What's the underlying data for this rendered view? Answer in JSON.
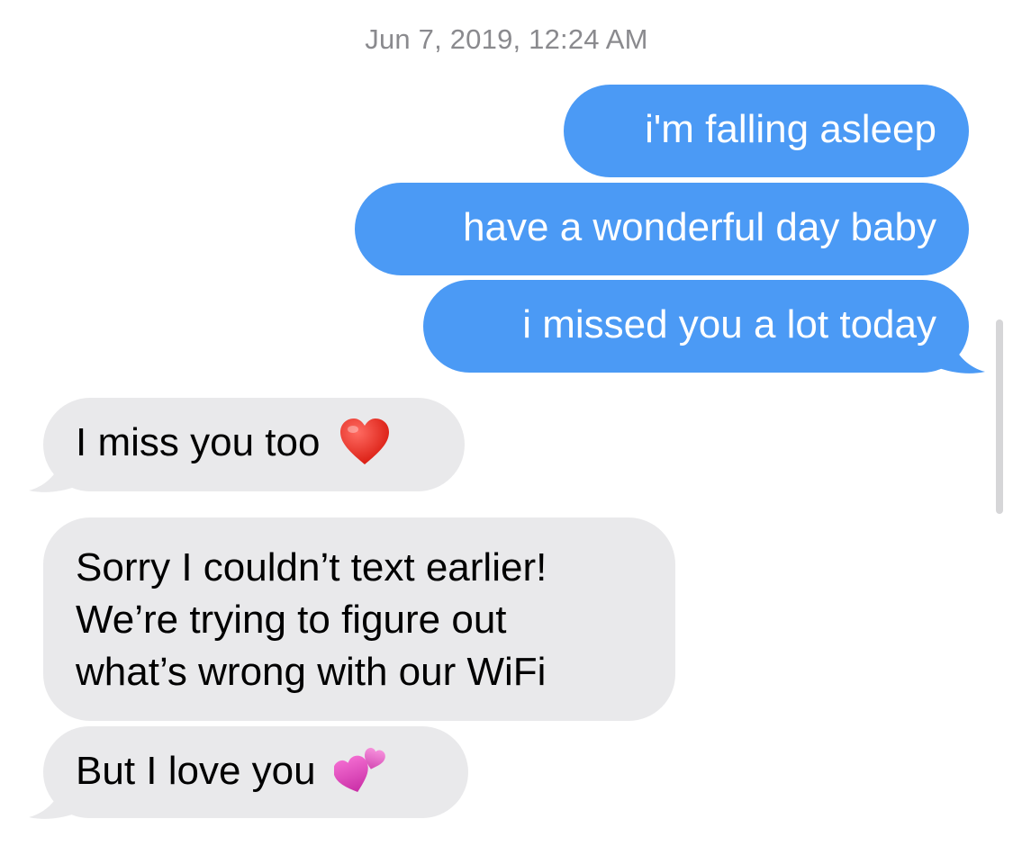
{
  "conversation": {
    "timestamp": "Jun 7, 2019, 12:24 AM",
    "messages": [
      {
        "direction": "outgoing",
        "text": "i'm falling asleep"
      },
      {
        "direction": "outgoing",
        "text": "have a wonderful day baby"
      },
      {
        "direction": "outgoing",
        "text": "i missed you a lot today"
      },
      {
        "direction": "incoming",
        "text": "I miss you too",
        "emoji": "red-heart-icon"
      },
      {
        "direction": "incoming",
        "lines": [
          "Sorry I couldn’t text earlier!",
          "We’re trying to figure out",
          "what’s wrong with our WiFi"
        ]
      },
      {
        "direction": "incoming",
        "text": "But I love you",
        "emoji": "two-hearts-icon"
      }
    ]
  },
  "colors": {
    "outgoing_bubble": "#4b9af5",
    "incoming_bubble": "#e9e9eb",
    "timestamp_text": "#8a8a8e"
  }
}
